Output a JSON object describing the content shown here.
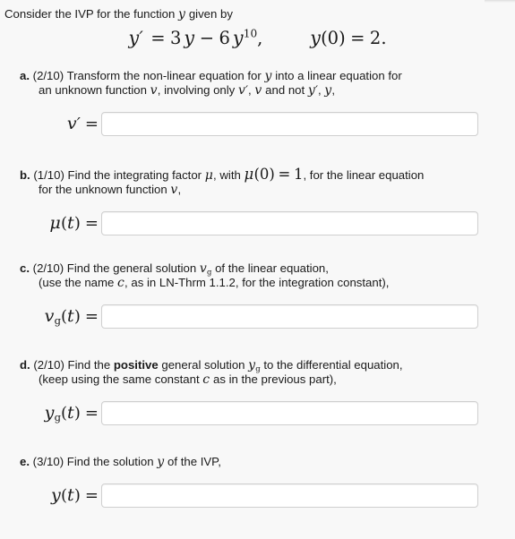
{
  "problem": {
    "intro_before": "Consider the IVP for the function",
    "intro_var": "y",
    "intro_after": "given by",
    "equation": {
      "lhs_var": "y",
      "lhs_prime": "′",
      "eq_sign": "=",
      "coef1": "3",
      "term1_var": "y",
      "minus": "−",
      "coef2": "6",
      "term2_var": "y",
      "term2_exponent": "10",
      "comma": ",",
      "initial_var": "y",
      "initial_open": "(",
      "initial_arg": "0",
      "initial_close": ")",
      "initial_eq": "=",
      "initial_value": "2",
      "period": "."
    }
  },
  "parts": [
    {
      "marker": "a.",
      "points": "(2/10)",
      "line1_a": "Transform the non-linear equation for",
      "line1_var": "y",
      "line1_b": "into a linear equation for",
      "line2_a": "an unknown function",
      "line2_var1": "v",
      "line2_b": ", involving only",
      "line2_var2": "v",
      "line2_prime2": "′",
      "line2_c": ",",
      "line2_var3": "v",
      "line2_d": "and not",
      "line2_var4": "y",
      "line2_prime4": "′",
      "line2_e": ",",
      "line2_var5": "y",
      "line2_f": ",",
      "answer_label_var": "v",
      "answer_label_prime": "′",
      "answer_label_eq": "=",
      "answer_value": "",
      "answer_placeholder": ""
    },
    {
      "marker": "b.",
      "points": "(1/10)",
      "line1_a": "Find the integrating factor",
      "line1_var": "μ",
      "line1_b": ", with",
      "line1_mu": "μ",
      "line1_open": "(",
      "line1_arg": "0",
      "line1_close": ")",
      "line1_eq": "=",
      "line1_val": "1",
      "line1_c": ", for the linear equation",
      "line2_a": "for the unknown function",
      "line2_var": "v",
      "line2_b": ",",
      "answer_label_var": "μ",
      "answer_label_open": "(",
      "answer_label_arg": "t",
      "answer_label_close": ")",
      "answer_label_eq": "=",
      "answer_value": "",
      "answer_placeholder": ""
    },
    {
      "marker": "c.",
      "points": "(2/10)",
      "line1_a": "Find the general solution",
      "line1_var": "v",
      "line1_sub": "g",
      "line1_b": "of the linear equation,",
      "line2_a": "(use the name",
      "line2_var": "c",
      "line2_b": ", as in LN-Thrm 1.1.2, for the integration constant),",
      "answer_label_var": "v",
      "answer_label_sub": "g",
      "answer_label_open": "(",
      "answer_label_arg": "t",
      "answer_label_close": ")",
      "answer_label_eq": "=",
      "answer_value": "",
      "answer_placeholder": ""
    },
    {
      "marker": "d.",
      "points": "(2/10)",
      "line1_a": "Find the",
      "line1_bold": "positive",
      "line1_b": "general solution",
      "line1_var": "y",
      "line1_sub": "g",
      "line1_c": "to the differential equation,",
      "line2_a": "(keep using the same constant",
      "line2_var": "c",
      "line2_b": "as in the previous part),",
      "answer_label_var": "y",
      "answer_label_sub": "g",
      "answer_label_open": "(",
      "answer_label_arg": "t",
      "answer_label_close": ")",
      "answer_label_eq": "=",
      "answer_value": "",
      "answer_placeholder": ""
    },
    {
      "marker": "e.",
      "points": "(3/10)",
      "line1_a": "Find the solution",
      "line1_var": "y",
      "line1_b": "of the IVP,",
      "answer_label_var": "y",
      "answer_label_open": "(",
      "answer_label_arg": "t",
      "answer_label_close": ")",
      "answer_label_eq": "=",
      "answer_value": "",
      "answer_placeholder": ""
    }
  ],
  "colors": {
    "background": "#f8f8f8",
    "text": "#1a1a1a",
    "input_background": "#ffffff",
    "input_border": "#cfcfcf"
  }
}
